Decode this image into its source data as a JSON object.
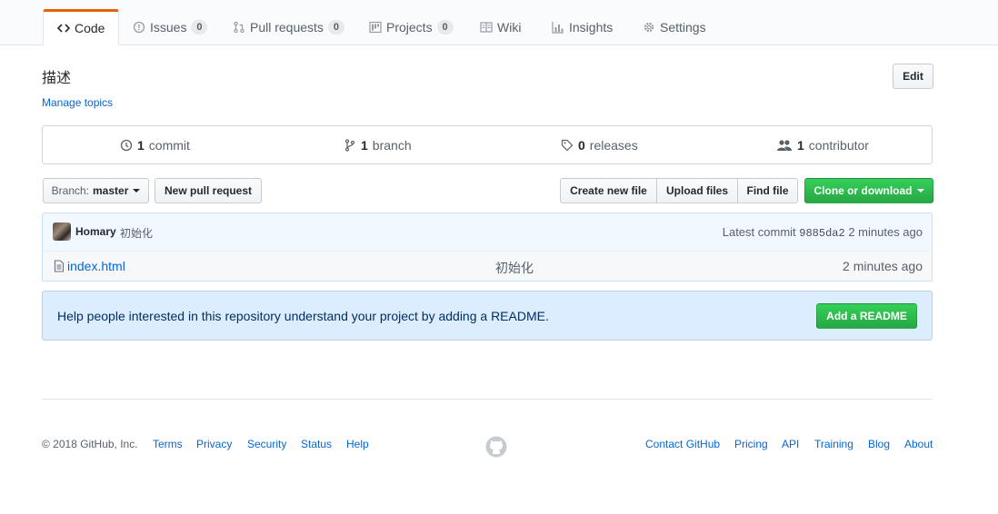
{
  "tabs": [
    {
      "label": "Code",
      "icon": "code-icon",
      "selected": true
    },
    {
      "label": "Issues",
      "icon": "issue-icon",
      "count": "0"
    },
    {
      "label": "Pull requests",
      "icon": "pull-request-icon",
      "count": "0"
    },
    {
      "label": "Projects",
      "icon": "project-icon",
      "count": "0"
    },
    {
      "label": "Wiki",
      "icon": "book-icon"
    },
    {
      "label": "Insights",
      "icon": "graph-icon"
    },
    {
      "label": "Settings",
      "icon": "gear-icon"
    }
  ],
  "repo": {
    "description": "描述",
    "edit_label": "Edit",
    "manage_topics": "Manage topics"
  },
  "summary": {
    "commits_count": "1",
    "commits_label": "commit",
    "branches_count": "1",
    "branches_label": "branch",
    "releases_count": "0",
    "releases_label": "releases",
    "contributors_count": "1",
    "contributors_label": "contributor"
  },
  "toolbar": {
    "branch_prefix": "Branch:",
    "branch_name": "master",
    "new_pull_request": "New pull request",
    "create_new_file": "Create new file",
    "upload_files": "Upload files",
    "find_file": "Find file",
    "clone_or_download": "Clone or download"
  },
  "commit": {
    "author": "Homary",
    "message": "初始化",
    "latest_label": "Latest commit",
    "sha": "9885da2",
    "age": "2 minutes ago"
  },
  "files": [
    {
      "name": "index.html",
      "message": "初始化",
      "age": "2 minutes ago"
    }
  ],
  "readme_banner": {
    "text": "Help people interested in this repository understand your project by adding a README.",
    "button": "Add a README"
  },
  "footer": {
    "copyright": "© 2018 GitHub, Inc.",
    "left_links": [
      "Terms",
      "Privacy",
      "Security",
      "Status",
      "Help"
    ],
    "right_links": [
      "Contact GitHub",
      "Pricing",
      "API",
      "Training",
      "Blog",
      "About"
    ]
  },
  "colors": {
    "link": "#0366d6",
    "primary_green": "#28a745",
    "tab_accent": "#e36209",
    "readme_bg": "#dbedff"
  }
}
